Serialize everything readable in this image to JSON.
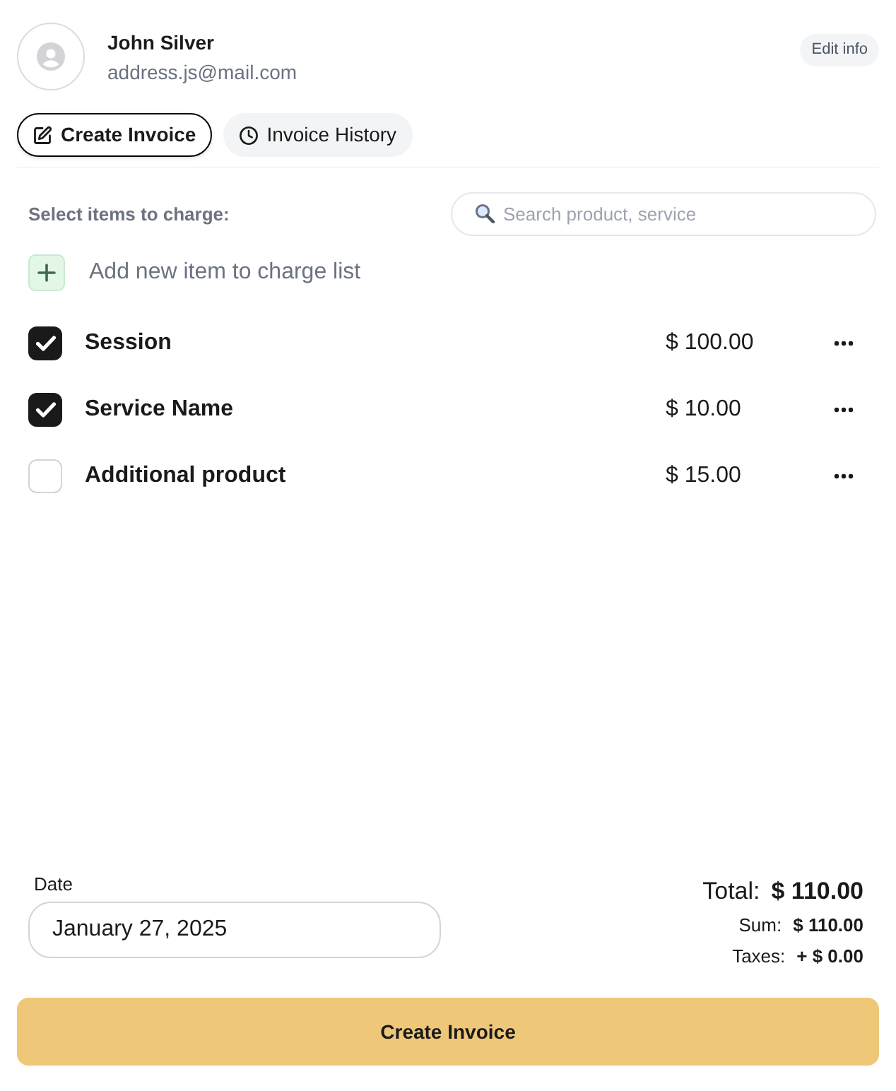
{
  "profile": {
    "name": "John Silver",
    "email": "address.js@mail.com",
    "edit_button": "Edit info"
  },
  "tabs": [
    {
      "label": "Create Invoice",
      "kind": "edit",
      "selected": true
    },
    {
      "label": "Invoice History",
      "kind": "history",
      "selected": false
    }
  ],
  "items_section": {
    "heading": "Select items to charge:",
    "search": {
      "placeholder": "Search product, service"
    },
    "add_item": "Add new item to charge list"
  },
  "items": [
    {
      "name": "Session",
      "price": "$ 100.00",
      "checked": true
    },
    {
      "name": "Service Name",
      "price": "$ 10.00",
      "checked": true
    },
    {
      "name": "Additional product",
      "price": "$ 15.00",
      "checked": false
    }
  ],
  "date": {
    "label": "Date",
    "value": "January 27, 2025"
  },
  "totals": {
    "total_label": "Total:",
    "total_value": "$ 110.00",
    "sum_label": "Sum:",
    "sum_value": "$ 110.00",
    "taxes_label": "Taxes:",
    "taxes_value": "+ $ 0.00"
  },
  "submit_button": "Create Invoice"
}
